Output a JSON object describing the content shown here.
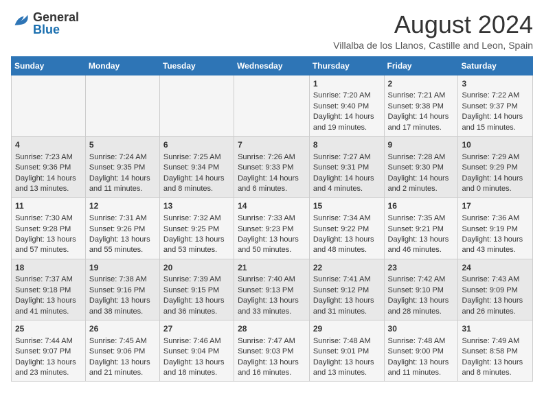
{
  "header": {
    "logo_general": "General",
    "logo_blue": "Blue",
    "title": "August 2024",
    "subtitle": "Villalba de los Llanos, Castille and Leon, Spain"
  },
  "columns": [
    "Sunday",
    "Monday",
    "Tuesday",
    "Wednesday",
    "Thursday",
    "Friday",
    "Saturday"
  ],
  "weeks": [
    [
      {
        "day": "",
        "info": ""
      },
      {
        "day": "",
        "info": ""
      },
      {
        "day": "",
        "info": ""
      },
      {
        "day": "",
        "info": ""
      },
      {
        "day": "1",
        "info": "Sunrise: 7:20 AM\nSunset: 9:40 PM\nDaylight: 14 hours and 19 minutes."
      },
      {
        "day": "2",
        "info": "Sunrise: 7:21 AM\nSunset: 9:38 PM\nDaylight: 14 hours and 17 minutes."
      },
      {
        "day": "3",
        "info": "Sunrise: 7:22 AM\nSunset: 9:37 PM\nDaylight: 14 hours and 15 minutes."
      }
    ],
    [
      {
        "day": "4",
        "info": "Sunrise: 7:23 AM\nSunset: 9:36 PM\nDaylight: 14 hours and 13 minutes."
      },
      {
        "day": "5",
        "info": "Sunrise: 7:24 AM\nSunset: 9:35 PM\nDaylight: 14 hours and 11 minutes."
      },
      {
        "day": "6",
        "info": "Sunrise: 7:25 AM\nSunset: 9:34 PM\nDaylight: 14 hours and 8 minutes."
      },
      {
        "day": "7",
        "info": "Sunrise: 7:26 AM\nSunset: 9:33 PM\nDaylight: 14 hours and 6 minutes."
      },
      {
        "day": "8",
        "info": "Sunrise: 7:27 AM\nSunset: 9:31 PM\nDaylight: 14 hours and 4 minutes."
      },
      {
        "day": "9",
        "info": "Sunrise: 7:28 AM\nSunset: 9:30 PM\nDaylight: 14 hours and 2 minutes."
      },
      {
        "day": "10",
        "info": "Sunrise: 7:29 AM\nSunset: 9:29 PM\nDaylight: 14 hours and 0 minutes."
      }
    ],
    [
      {
        "day": "11",
        "info": "Sunrise: 7:30 AM\nSunset: 9:28 PM\nDaylight: 13 hours and 57 minutes."
      },
      {
        "day": "12",
        "info": "Sunrise: 7:31 AM\nSunset: 9:26 PM\nDaylight: 13 hours and 55 minutes."
      },
      {
        "day": "13",
        "info": "Sunrise: 7:32 AM\nSunset: 9:25 PM\nDaylight: 13 hours and 53 minutes."
      },
      {
        "day": "14",
        "info": "Sunrise: 7:33 AM\nSunset: 9:23 PM\nDaylight: 13 hours and 50 minutes."
      },
      {
        "day": "15",
        "info": "Sunrise: 7:34 AM\nSunset: 9:22 PM\nDaylight: 13 hours and 48 minutes."
      },
      {
        "day": "16",
        "info": "Sunrise: 7:35 AM\nSunset: 9:21 PM\nDaylight: 13 hours and 46 minutes."
      },
      {
        "day": "17",
        "info": "Sunrise: 7:36 AM\nSunset: 9:19 PM\nDaylight: 13 hours and 43 minutes."
      }
    ],
    [
      {
        "day": "18",
        "info": "Sunrise: 7:37 AM\nSunset: 9:18 PM\nDaylight: 13 hours and 41 minutes."
      },
      {
        "day": "19",
        "info": "Sunrise: 7:38 AM\nSunset: 9:16 PM\nDaylight: 13 hours and 38 minutes."
      },
      {
        "day": "20",
        "info": "Sunrise: 7:39 AM\nSunset: 9:15 PM\nDaylight: 13 hours and 36 minutes."
      },
      {
        "day": "21",
        "info": "Sunrise: 7:40 AM\nSunset: 9:13 PM\nDaylight: 13 hours and 33 minutes."
      },
      {
        "day": "22",
        "info": "Sunrise: 7:41 AM\nSunset: 9:12 PM\nDaylight: 13 hours and 31 minutes."
      },
      {
        "day": "23",
        "info": "Sunrise: 7:42 AM\nSunset: 9:10 PM\nDaylight: 13 hours and 28 minutes."
      },
      {
        "day": "24",
        "info": "Sunrise: 7:43 AM\nSunset: 9:09 PM\nDaylight: 13 hours and 26 minutes."
      }
    ],
    [
      {
        "day": "25",
        "info": "Sunrise: 7:44 AM\nSunset: 9:07 PM\nDaylight: 13 hours and 23 minutes."
      },
      {
        "day": "26",
        "info": "Sunrise: 7:45 AM\nSunset: 9:06 PM\nDaylight: 13 hours and 21 minutes."
      },
      {
        "day": "27",
        "info": "Sunrise: 7:46 AM\nSunset: 9:04 PM\nDaylight: 13 hours and 18 minutes."
      },
      {
        "day": "28",
        "info": "Sunrise: 7:47 AM\nSunset: 9:03 PM\nDaylight: 13 hours and 16 minutes."
      },
      {
        "day": "29",
        "info": "Sunrise: 7:48 AM\nSunset: 9:01 PM\nDaylight: 13 hours and 13 minutes."
      },
      {
        "day": "30",
        "info": "Sunrise: 7:48 AM\nSunset: 9:00 PM\nDaylight: 13 hours and 11 minutes."
      },
      {
        "day": "31",
        "info": "Sunrise: 7:49 AM\nSunset: 8:58 PM\nDaylight: 13 hours and 8 minutes."
      }
    ]
  ]
}
